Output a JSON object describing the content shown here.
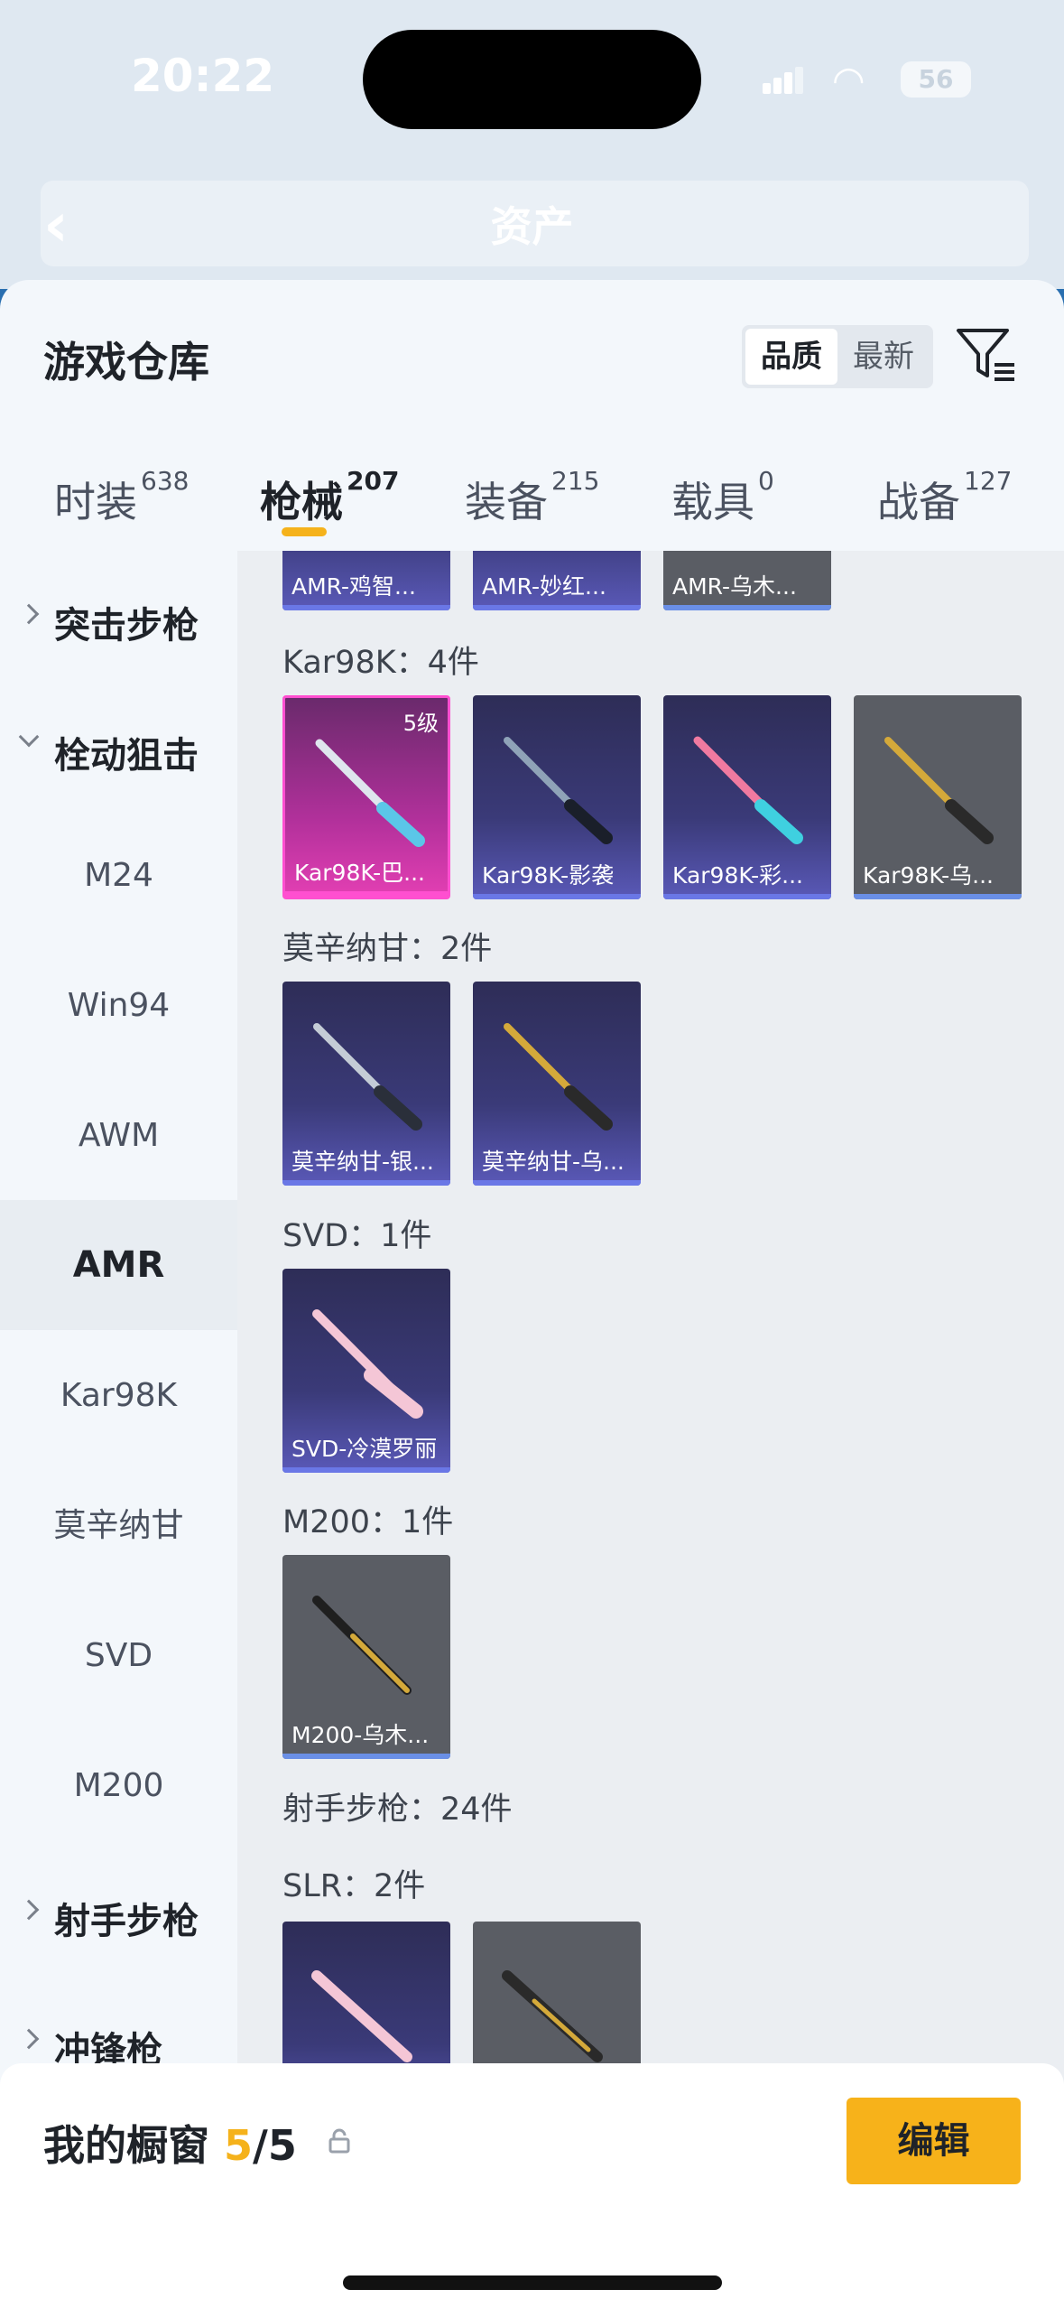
{
  "status_bar": {
    "time": "20:22",
    "battery": "56"
  },
  "background_page": {
    "title": "资产"
  },
  "sheet": {
    "title": "游戏仓库",
    "sort_options": [
      "品质",
      "最新"
    ],
    "sort_selected": "品质"
  },
  "tabs": [
    {
      "label": "时装",
      "count": "638"
    },
    {
      "label": "枪械",
      "count": "207"
    },
    {
      "label": "装备",
      "count": "215"
    },
    {
      "label": "载具",
      "count": "0"
    },
    {
      "label": "战备",
      "count": "127"
    }
  ],
  "active_tab": "枪械",
  "sidebar": {
    "categories": [
      {
        "label": "突击步枪"
      },
      {
        "label": "栓动狙击"
      },
      {
        "label": "射手步枪"
      },
      {
        "label": "冲锋枪"
      }
    ],
    "subitems": [
      "M24",
      "Win94",
      "AWM",
      "AMR",
      "Kar98K",
      "莫辛纳甘",
      "SVD",
      "M200"
    ],
    "selected_sub": "AMR"
  },
  "content": {
    "amr_items": [
      "AMR-鸡智...",
      "AMR-妙红...",
      "AMR-乌木..."
    ],
    "groups": [
      {
        "title": "Kar98K：4件",
        "items": [
          {
            "name": "Kar98K-巴...",
            "level": "5级",
            "tier": "pink"
          },
          {
            "name": "Kar98K-影袭",
            "tier": "blue"
          },
          {
            "name": "Kar98K-彩...",
            "tier": "blue"
          },
          {
            "name": "Kar98K-乌...",
            "tier": "gray"
          }
        ]
      },
      {
        "title": "莫辛纳甘：2件",
        "items": [
          {
            "name": "莫辛纳甘-银...",
            "tier": "blue"
          },
          {
            "name": "莫辛纳甘-乌...",
            "tier": "blue"
          }
        ]
      },
      {
        "title": "SVD：1件",
        "items": [
          {
            "name": "SVD-冷漠罗丽",
            "tier": "blue"
          }
        ]
      },
      {
        "title": "M200：1件",
        "items": [
          {
            "name": "M200-乌木...",
            "tier": "gray"
          }
        ]
      }
    ],
    "section_title": "射手步枪：24件",
    "slr_title": "SLR：2件"
  },
  "bottom_bar": {
    "label": "我的橱窗",
    "count": "5",
    "total": "/5",
    "edit_label": "编辑"
  },
  "colors": {
    "accent": "#f5b21b",
    "pink_tier": "#e33fb3",
    "blue_tier": "#5a59b8",
    "gray_tier": "#5a5d64"
  }
}
